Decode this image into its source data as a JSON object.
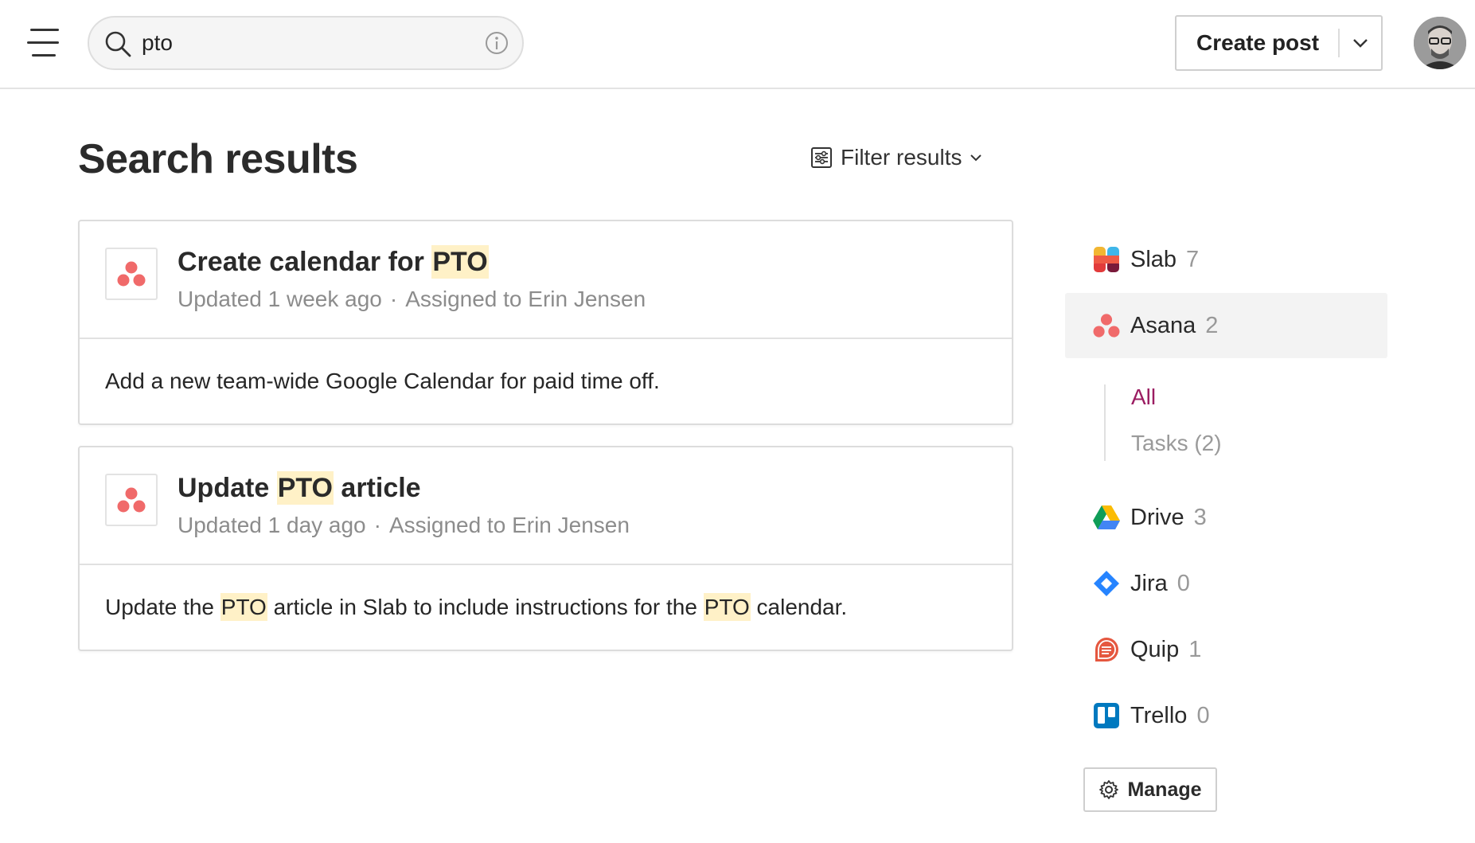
{
  "topbar": {
    "search_value": "pto",
    "create_post_label": "Create post"
  },
  "header": {
    "title": "Search results",
    "filter_label": "Filter results"
  },
  "results": [
    {
      "title_prefix": "Create calendar for ",
      "title_highlight": "PTO",
      "title_suffix": "",
      "updated": "Updated 1 week ago",
      "separator": "·",
      "assigned": "Assigned to Erin Jensen",
      "body_parts": [
        "Add a new team-wide Google Calendar for paid time off."
      ]
    },
    {
      "title_prefix": "Update ",
      "title_highlight": "PTO",
      "title_suffix": " article",
      "updated": "Updated 1 day ago",
      "separator": "·",
      "assigned": "Assigned to Erin Jensen",
      "body_parts": [
        "Update the ",
        "PTO",
        " article in Slab to include instructions for the ",
        "PTO",
        " calendar."
      ]
    }
  ],
  "sidebar": {
    "sources": [
      {
        "name": "Slab",
        "count": "7",
        "icon": "slab-icon"
      },
      {
        "name": "Asana",
        "count": "2",
        "icon": "asana-icon"
      },
      {
        "name": "Drive",
        "count": "3",
        "icon": "drive-icon"
      },
      {
        "name": "Jira",
        "count": "0",
        "icon": "jira-icon"
      },
      {
        "name": "Quip",
        "count": "1",
        "icon": "quip-icon"
      },
      {
        "name": "Trello",
        "count": "0",
        "icon": "trello-icon"
      }
    ],
    "asana_sub": {
      "all": "All",
      "tasks": "Tasks (2)"
    },
    "manage_label": "Manage"
  },
  "colors": {
    "accent": "#9b1d62",
    "highlight": "#fff1c7",
    "asana": "#f06a6a"
  }
}
